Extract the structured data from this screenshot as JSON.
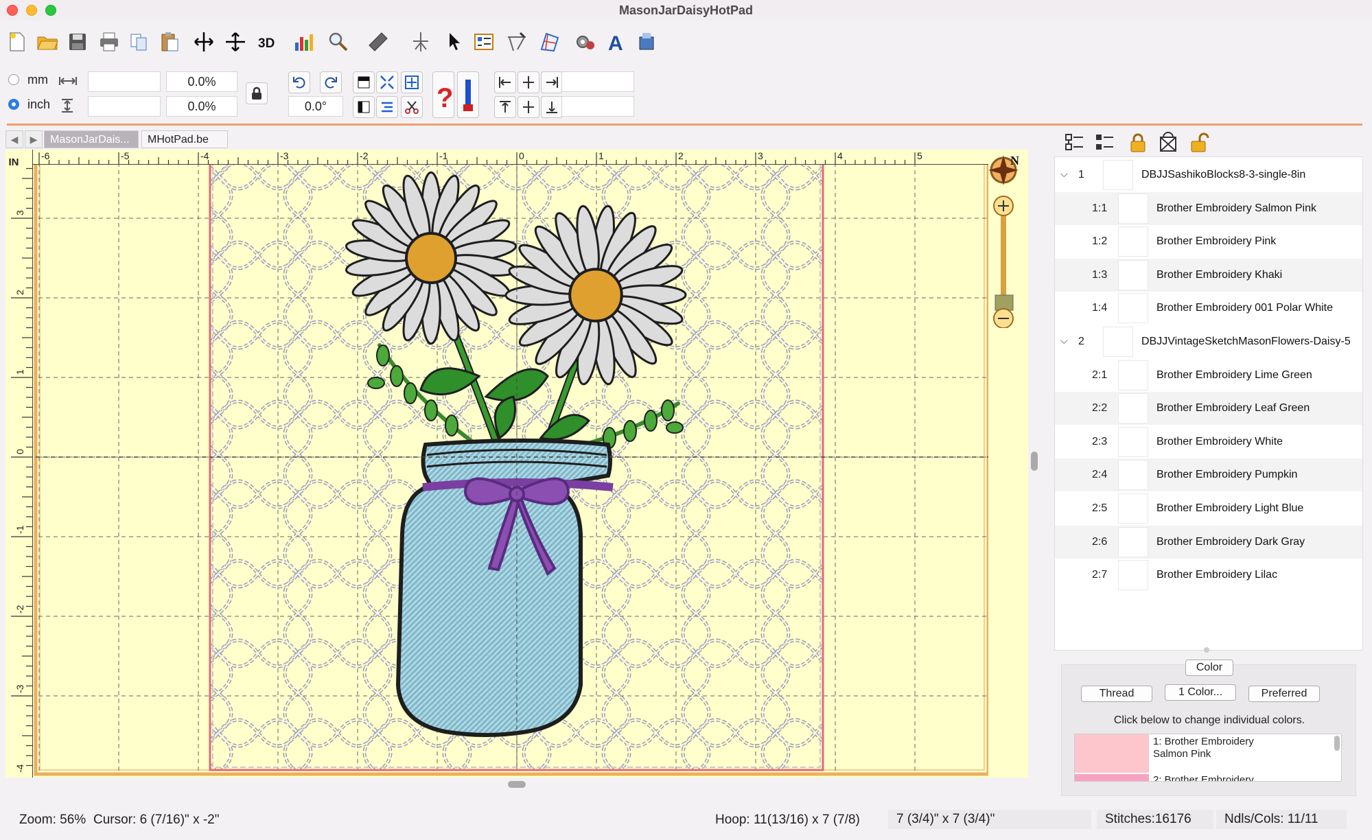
{
  "window": {
    "title": "MasonJarDaisyHotPad"
  },
  "units": {
    "mm_label": "mm",
    "inch_label": "inch",
    "selected": "inch"
  },
  "fields": {
    "width_value": "",
    "height_value": "",
    "width_percent": "0.0%",
    "height_percent": "0.0%",
    "rotation": "0.0°",
    "extra1": "",
    "extra2": ""
  },
  "tabs": [
    {
      "label": "MasonJarDais...",
      "active": true
    },
    {
      "label": "MHotPad.be",
      "active": false
    }
  ],
  "rulers": {
    "unit_label": "IN",
    "top_ticks": [
      "-6",
      "-5",
      "-4",
      "-3",
      "-2",
      "-1",
      "0",
      "1",
      "2",
      "3",
      "4",
      "5"
    ],
    "left_ticks": [
      "3",
      "2",
      "1",
      "0",
      "-1",
      "-2",
      "-3",
      "-4"
    ]
  },
  "compass_label": "N",
  "tree": {
    "items": [
      {
        "num": "1",
        "label": "DBJJSashikoBlocks8-3-single-8in",
        "group": true
      },
      {
        "num": "1:1",
        "label": "Brother Embroidery Salmon Pink"
      },
      {
        "num": "1:2",
        "label": "Brother Embroidery Pink"
      },
      {
        "num": "1:3",
        "label": "Brother Embroidery Khaki"
      },
      {
        "num": "1:4",
        "label": "Brother Embroidery 001 Polar White"
      },
      {
        "num": "2",
        "label": "DBJJVintageSketchMasonFlowers-Daisy-5",
        "group": true
      },
      {
        "num": "2:1",
        "label": "Brother Embroidery Lime Green"
      },
      {
        "num": "2:2",
        "label": "Brother Embroidery Leaf Green"
      },
      {
        "num": "2:3",
        "label": "Brother Embroidery White"
      },
      {
        "num": "2:4",
        "label": "Brother Embroidery Pumpkin"
      },
      {
        "num": "2:5",
        "label": "Brother Embroidery Light Blue"
      },
      {
        "num": "2:6",
        "label": "Brother Embroidery Dark Gray"
      },
      {
        "num": "2:7",
        "label": "Brother Embroidery Lilac"
      }
    ]
  },
  "color_panel": {
    "header": "Color",
    "thread_btn": "Thread",
    "one_color_btn": "1 Color...",
    "preferred_btn": "Preferred",
    "hint": "Click below to change individual colors.",
    "list": [
      {
        "text_line1": "1: Brother Embroidery",
        "text_line2": "Salmon Pink",
        "color": "#fcc6cc"
      },
      {
        "text_line1": "2: Brother Embroidery",
        "text_line2": "",
        "color": "#f7a3c0"
      }
    ]
  },
  "status": {
    "zoom": "Zoom: 56%",
    "cursor": "Cursor: 6 (7/16)\" x -2\"",
    "hoop": "Hoop: 11(13/16) x 7 (7/8)",
    "size": "7 (3/4)\" x 7 (3/4)\"",
    "stitches": "Stitches:16176",
    "ndls": "Ndls/Cols: 11/11"
  },
  "colors": {
    "canvas": "#ffffcc",
    "hoop": "#e8b060",
    "jar": "#8fc4d4",
    "ribbon": "#7a3fa0",
    "petal": "#dcdcdc",
    "center": "#e0a030",
    "leaf": "#3a9a30",
    "accent_line": "#f0a06a"
  }
}
